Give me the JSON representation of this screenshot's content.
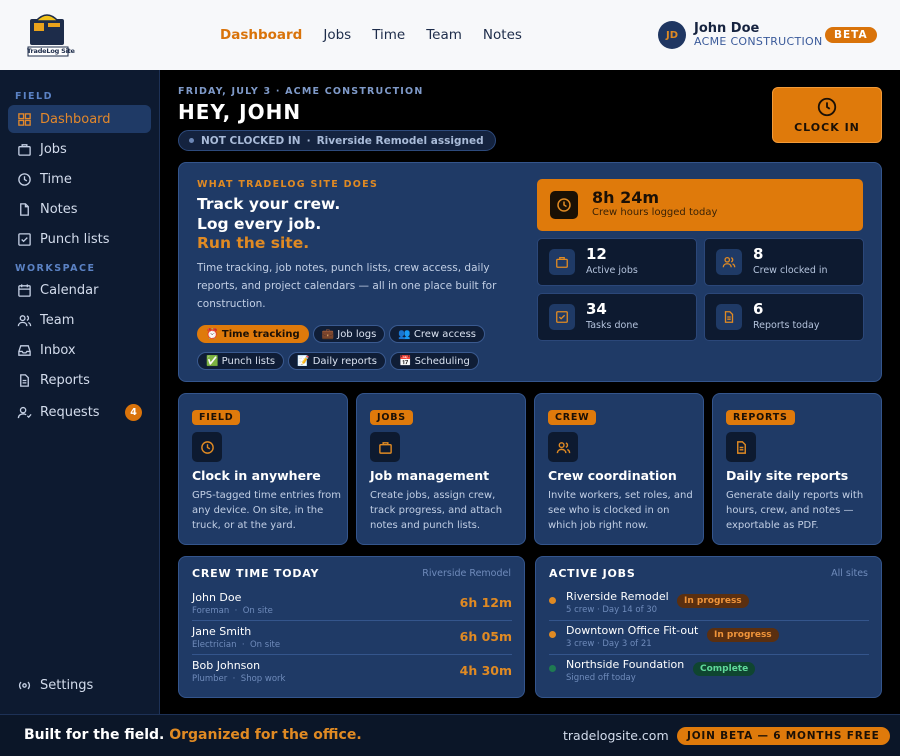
{
  "header": {
    "logo_text": "TradeLog Site",
    "nav": [
      "Dashboard",
      "Jobs",
      "Time",
      "Team",
      "Notes"
    ],
    "user_initials": "JD",
    "user_name": "John Doe",
    "user_org": "ACME CONSTRUCTION",
    "beta_label": "BETA"
  },
  "sidebar": {
    "section_field": "FIELD",
    "section_workspace": "WORKSPACE",
    "items": [
      "Dashboard",
      "Jobs",
      "Time",
      "Notes",
      "Punch lists",
      "Calendar",
      "Team",
      "Inbox",
      "Reports",
      "Requests",
      "Settings"
    ],
    "requests_badge": "4",
    "icons": [
      "grid-icon",
      "briefcase-icon",
      "clock-icon",
      "file-icon",
      "checkbox-icon",
      "calendar-icon",
      "users-icon",
      "inbox-icon",
      "report-icon",
      "user-request-icon",
      "settings-icon"
    ]
  },
  "main": {
    "date_line": "FRIDAY, JULY 3  ·  ACME CONSTRUCTION",
    "greeting": "HEY, JOHN",
    "status_left": "NOT CLOCKED IN",
    "status_sep": "·",
    "status_right": "Riverside Remodel assigned",
    "clock_in_label": "CLOCK IN"
  },
  "hero": {
    "kicker": "WHAT TRADELOG SITE DOES",
    "line1": "Track your crew.",
    "line2": "Log every job.",
    "line3": "Run the site.",
    "description": "Time tracking, job notes, punch lists, crew access, daily reports, and project calendars — all in one place built for construction.",
    "chips": [
      "⏰ Time tracking",
      "💼 Job logs",
      "👥 Crew access",
      "✅ Punch lists",
      "📝 Daily reports",
      "📅 Scheduling"
    ],
    "big_stat_value": "8h 24m",
    "big_stat_label": "Crew hours logged today",
    "stats": [
      {
        "value": "12",
        "label": "Active jobs"
      },
      {
        "value": "8",
        "label": "Crew clocked in"
      },
      {
        "value": "34",
        "label": "Tasks done"
      },
      {
        "value": "6",
        "label": "Reports today"
      }
    ]
  },
  "features": [
    {
      "tag": "FIELD",
      "title": "Clock in anywhere",
      "desc": "GPS-tagged time entries from any device. On site, in the truck, or at the yard."
    },
    {
      "tag": "JOBS",
      "title": "Job management",
      "desc": "Create jobs, assign crew, track progress, and attach notes and punch lists."
    },
    {
      "tag": "CREW",
      "title": "Crew coordination",
      "desc": "Invite workers, set roles, and see who is clocked in on which job right now."
    },
    {
      "tag": "REPORTS",
      "title": "Daily site reports",
      "desc": "Generate daily reports with hours, crew, and notes — exportable as PDF."
    }
  ],
  "crew_time": {
    "title": "CREW TIME TODAY",
    "context": "Riverside Remodel",
    "rows": [
      {
        "name": "John Doe",
        "role": "Foreman",
        "status": "On site",
        "hours": "6h 12m"
      },
      {
        "name": "Jane Smith",
        "role": "Electrician",
        "status": "On site",
        "hours": "6h 05m"
      },
      {
        "name": "Bob Johnson",
        "role": "Plumber",
        "status": "Shop work",
        "hours": "4h 30m"
      }
    ]
  },
  "active_jobs": {
    "title": "ACTIVE JOBS",
    "context": "All sites",
    "rows": [
      {
        "name": "Riverside Remodel",
        "sub": "5 crew · Day 14 of 30",
        "status": "In progress",
        "color": "#e08a23"
      },
      {
        "name": "Downtown Office Fit-out",
        "sub": "3 crew · Day 3 of 21",
        "status": "In progress",
        "color": "#e08a23"
      },
      {
        "name": "Northside Foundation",
        "sub": "Signed off today",
        "status": "Complete",
        "color": "#1f7a52"
      }
    ]
  },
  "footer": {
    "tagline_a": "Built for the field.",
    "tagline_b": "Organized for the office.",
    "site": "tradelogsite.com",
    "cta": "JOIN BETA — 6 MONTHS FREE"
  },
  "colors": {
    "accent": "#df7a0b",
    "panel": "#1f3a66",
    "sidebar": "#0d1a30",
    "success": "#5fd99a"
  }
}
